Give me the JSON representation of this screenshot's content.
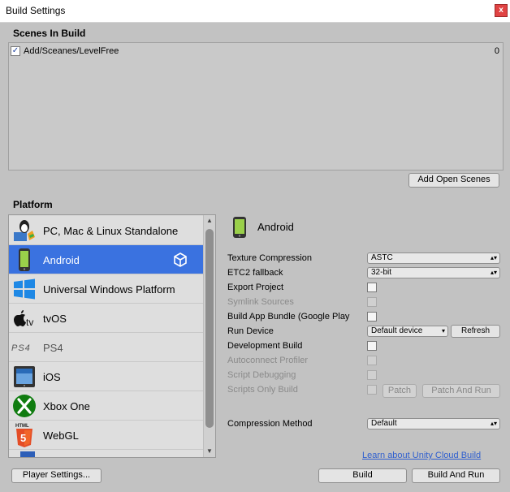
{
  "window": {
    "title": "Build Settings",
    "close_label": "x"
  },
  "scenes": {
    "heading": "Scenes In Build",
    "items": [
      {
        "name": "Add/Sceanes/LevelFree",
        "index": "0",
        "checked": true
      }
    ],
    "add_open_scenes": "Add Open Scenes"
  },
  "platform": {
    "heading": "Platform",
    "items": [
      {
        "label": "PC, Mac & Linux Standalone",
        "icon": "pc-mac-linux-icon"
      },
      {
        "label": "Android",
        "icon": "android-icon",
        "selected": true
      },
      {
        "label": "Universal Windows Platform",
        "icon": "windows-icon"
      },
      {
        "label": "tvOS",
        "icon": "apple-tv-icon"
      },
      {
        "label": "PS4",
        "icon": "ps4-icon"
      },
      {
        "label": "iOS",
        "icon": "ios-icon"
      },
      {
        "label": "Xbox One",
        "icon": "xbox-icon"
      },
      {
        "label": "WebGL",
        "icon": "html5-icon"
      }
    ]
  },
  "settings": {
    "header": "Android",
    "texture_compression": {
      "label": "Texture Compression",
      "value": "ASTC"
    },
    "etc2_fallback": {
      "label": "ETC2 fallback",
      "value": "32-bit"
    },
    "export_project": "Export Project",
    "symlink_sources": "Symlink Sources",
    "build_app_bundle": "Build App Bundle (Google Play",
    "run_device": {
      "label": "Run Device",
      "value": "Default device",
      "refresh": "Refresh"
    },
    "development_build": "Development Build",
    "autoconnect_profiler": "Autoconnect Profiler",
    "script_debugging": "Script Debugging",
    "scripts_only_build": "Scripts Only Build",
    "patch": "Patch",
    "patch_and_run": "Patch And Run",
    "compression_method": {
      "label": "Compression Method",
      "value": "Default"
    }
  },
  "footer": {
    "cloud_link": "Learn about Unity Cloud Build",
    "player_settings": "Player Settings...",
    "build": "Build",
    "build_and_run": "Build And Run"
  },
  "colors": {
    "selection": "#3a72e0",
    "background": "#c2c2c2",
    "link": "#2f5fcf"
  }
}
